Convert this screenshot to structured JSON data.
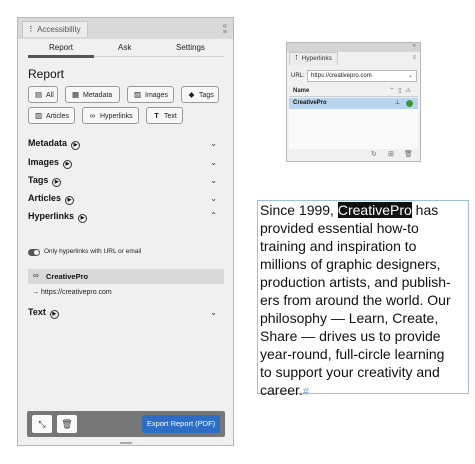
{
  "accessibility_panel": {
    "title": "Accessibility",
    "tabs": [
      "Report",
      "Ask",
      "Settings"
    ],
    "active_tab": "Report",
    "heading": "Report",
    "filters": [
      {
        "label": "All",
        "icon": "all-icon"
      },
      {
        "label": "Metadata",
        "icon": "metadata-icon"
      },
      {
        "label": "Images",
        "icon": "image-icon"
      },
      {
        "label": "Tags",
        "icon": "tag-icon"
      },
      {
        "label": "Articles",
        "icon": "articles-icon"
      },
      {
        "label": "Hyperlinks",
        "icon": "link-icon"
      },
      {
        "label": "Text",
        "icon": "text-icon"
      }
    ],
    "sections": [
      "Metadata",
      "Images",
      "Tags",
      "Articles",
      "Hyperlinks",
      "Text"
    ],
    "toggle_label": "Only hyperlinks with URL or email",
    "hyperlink": {
      "name": "CreativePro",
      "url": "→ https://creativepro.com"
    },
    "export_label": "Export Report (PDF)"
  },
  "hyperlinks_panel": {
    "title": "Hyperlinks",
    "url_label": "URL:",
    "url_value": "https://creativepro.com",
    "column_name": "Name",
    "row_name": "CreativePro"
  },
  "text_frame": {
    "lines": [
      {
        "pre": "Since 1999, ",
        "sel": "CreativePro",
        "post": " has"
      },
      {
        "pre": "provided essential how-to"
      },
      {
        "pre": "training and inspiration to"
      },
      {
        "pre": "millions of graphic designers,"
      },
      {
        "pre": "production artists, and publish-"
      },
      {
        "pre": "ers from around the world. Our"
      },
      {
        "pre": "philosophy — Learn, Create,"
      },
      {
        "pre": "Share — drives us to provide"
      },
      {
        "pre": "year-round, full-circle learning"
      },
      {
        "pre": "to support your creativity and"
      },
      {
        "pre": "career."
      }
    ],
    "end_mark": "#"
  },
  "colors": {
    "accent": "#2c6dc6",
    "selection": "#b8d4ee",
    "status_ok": "#3a9a3a"
  }
}
